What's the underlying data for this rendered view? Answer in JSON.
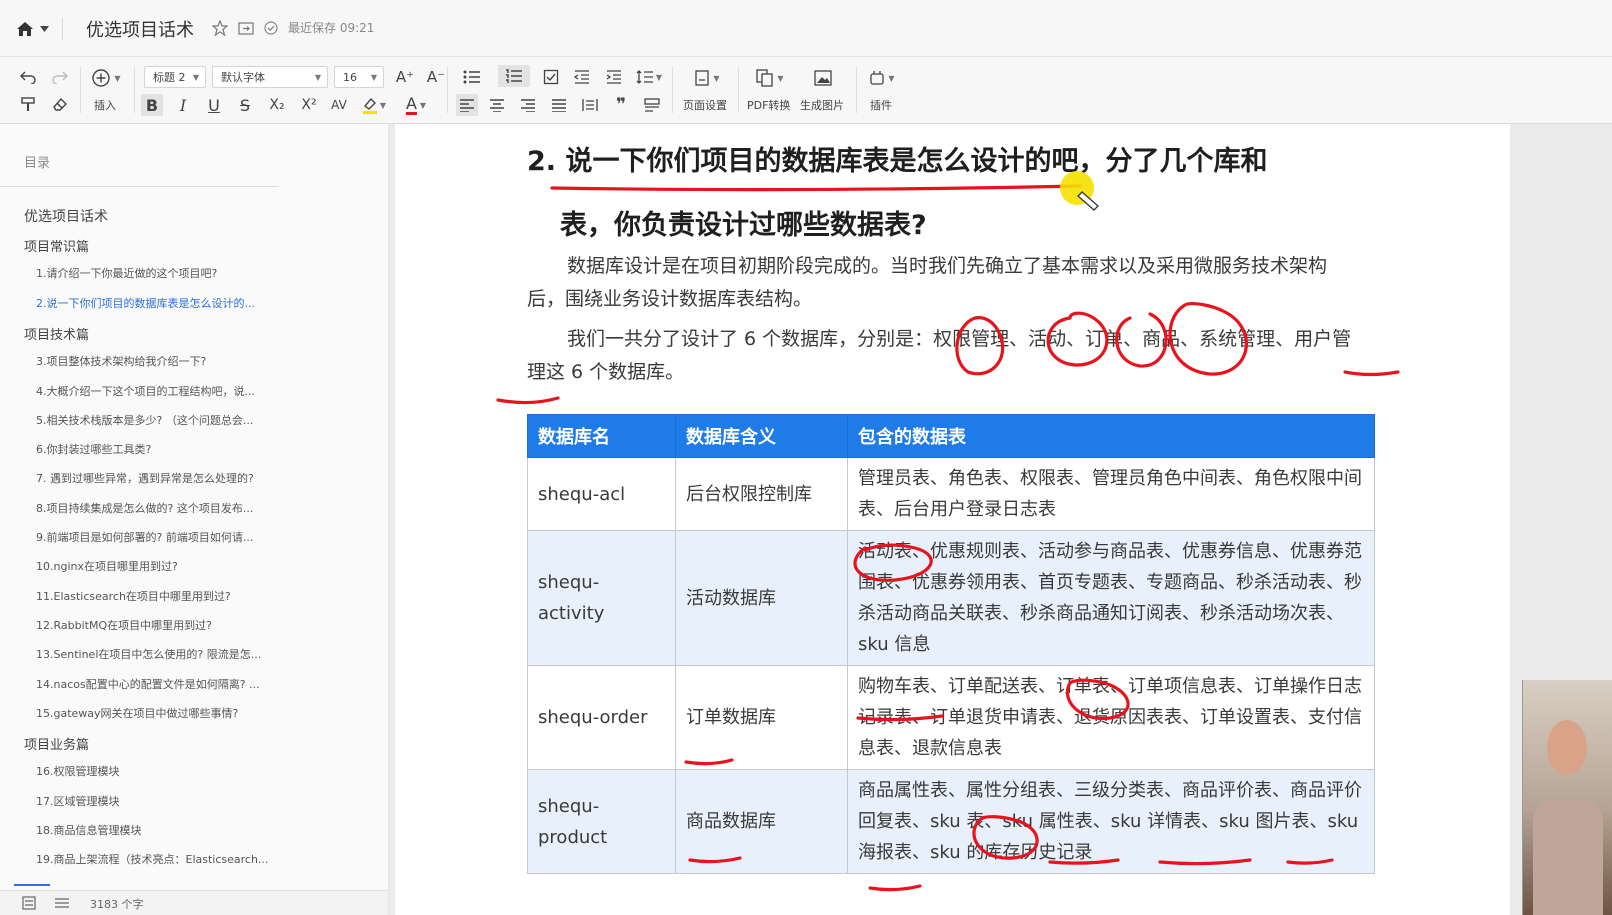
{
  "window": {
    "title": "优选项目话术",
    "save_status": "最近保存 09:21"
  },
  "toolbar": {
    "heading_style": "标题 2",
    "font_family": "默认字体",
    "font_size": "16",
    "insert_label": "插入",
    "page_setup_label": "页面设置",
    "pdf_label": "PDF转换",
    "image_label": "生成图片",
    "plugin_label": "插件"
  },
  "sidebar": {
    "header": "目录",
    "root": "优选项目话术",
    "items": [
      {
        "level": 2,
        "text": "项目常识篇"
      },
      {
        "level": 3,
        "text": "1.请介绍一下你最近做的这个项目吧?"
      },
      {
        "level": 3,
        "text": "2.说一下你们项目的数据库表是怎么设计的...",
        "active": true
      },
      {
        "level": 2,
        "text": "项目技术篇"
      },
      {
        "level": 3,
        "text": "3.项目整体技术架构给我介绍一下?"
      },
      {
        "level": 3,
        "text": "4.大概介绍一下这个项目的工程结构吧，说..."
      },
      {
        "level": 3,
        "text": "5.相关技术栈版本是多少? （这个问题总会..."
      },
      {
        "level": 3,
        "text": "6.你封装过哪些工具类?"
      },
      {
        "level": 3,
        "text": "7. 遇到过哪些异常，遇到异常是怎么处理的?"
      },
      {
        "level": 3,
        "text": "8.项目持续集成是怎么做的? 这个项目发布..."
      },
      {
        "level": 3,
        "text": "9.前端项目是如何部署的? 前端项目如何请..."
      },
      {
        "level": 3,
        "text": "10.nginx在项目哪里用到过?"
      },
      {
        "level": 3,
        "text": "11.Elasticsearch在项目中哪里用到过?"
      },
      {
        "level": 3,
        "text": "12.RabbitMQ在项目中哪里用到过?"
      },
      {
        "level": 3,
        "text": "13.Sentinel在项目中怎么使用的? 限流是怎..."
      },
      {
        "level": 3,
        "text": "14.nacos配置中心的配置文件是如何隔离? ..."
      },
      {
        "level": 3,
        "text": "15.gateway网关在项目中做过哪些事情?"
      },
      {
        "level": 2,
        "text": "项目业务篇"
      },
      {
        "level": 3,
        "text": "16.权限管理模块"
      },
      {
        "level": 3,
        "text": "17.区域管理模块"
      },
      {
        "level": 3,
        "text": "18.商品信息管理模块"
      },
      {
        "level": 3,
        "text": "19.商品上架流程（技术亮点：Elasticsearch..."
      }
    ],
    "word_count": "3183 个字"
  },
  "document": {
    "heading_line1": "2. 说一下你们项目的数据库表是怎么设计的吧，分了几个库和",
    "heading_line2": "表，你负责设计过哪些数据表?",
    "para1": "数据库设计是在项目初期阶段完成的。当时我们先确立了基本需求以及采用微服务技术架构后，围绕业务设计数据库表结构。",
    "para2": "我们一共分了设计了 6 个数据库，分别是：权限管理、活动、订单、商品、系统管理、用户管理这 6 个数据库。",
    "table": {
      "headers": [
        "数据库名",
        "数据库含义",
        "包含的数据表"
      ],
      "rows": [
        [
          "shequ-acl",
          "后台权限控制库",
          "管理员表、角色表、权限表、管理员角色中间表、角色权限中间表、后台用户登录日志表"
        ],
        [
          "shequ-activity",
          "活动数据库",
          "活动表、优惠规则表、活动参与商品表、优惠券信息、优惠券范围表、优惠券领用表、首页专题表、专题商品、秒杀活动表、秒杀活动商品关联表、秒杀商品通知订阅表、秒杀活动场次表、sku 信息"
        ],
        [
          "shequ-order",
          "订单数据库",
          "购物车表、订单配送表、订单表、订单项信息表、订单操作日志记录表、订单退货申请表、退货原因表表、订单设置表、支付信息表、退款信息表"
        ],
        [
          "shequ-product",
          "商品数据库",
          "商品属性表、属性分组表、三级分类表、商品评价表、商品评价回复表、sku 表、sku 属性表、sku 详情表、sku 图片表、sku 海报表、sku 的库存历史记录"
        ]
      ]
    }
  },
  "colors": {
    "accent": "#2b6fe0",
    "table_header": "#1e7be8",
    "annotation": "#e8131c",
    "highlighter": "#f6e000"
  }
}
